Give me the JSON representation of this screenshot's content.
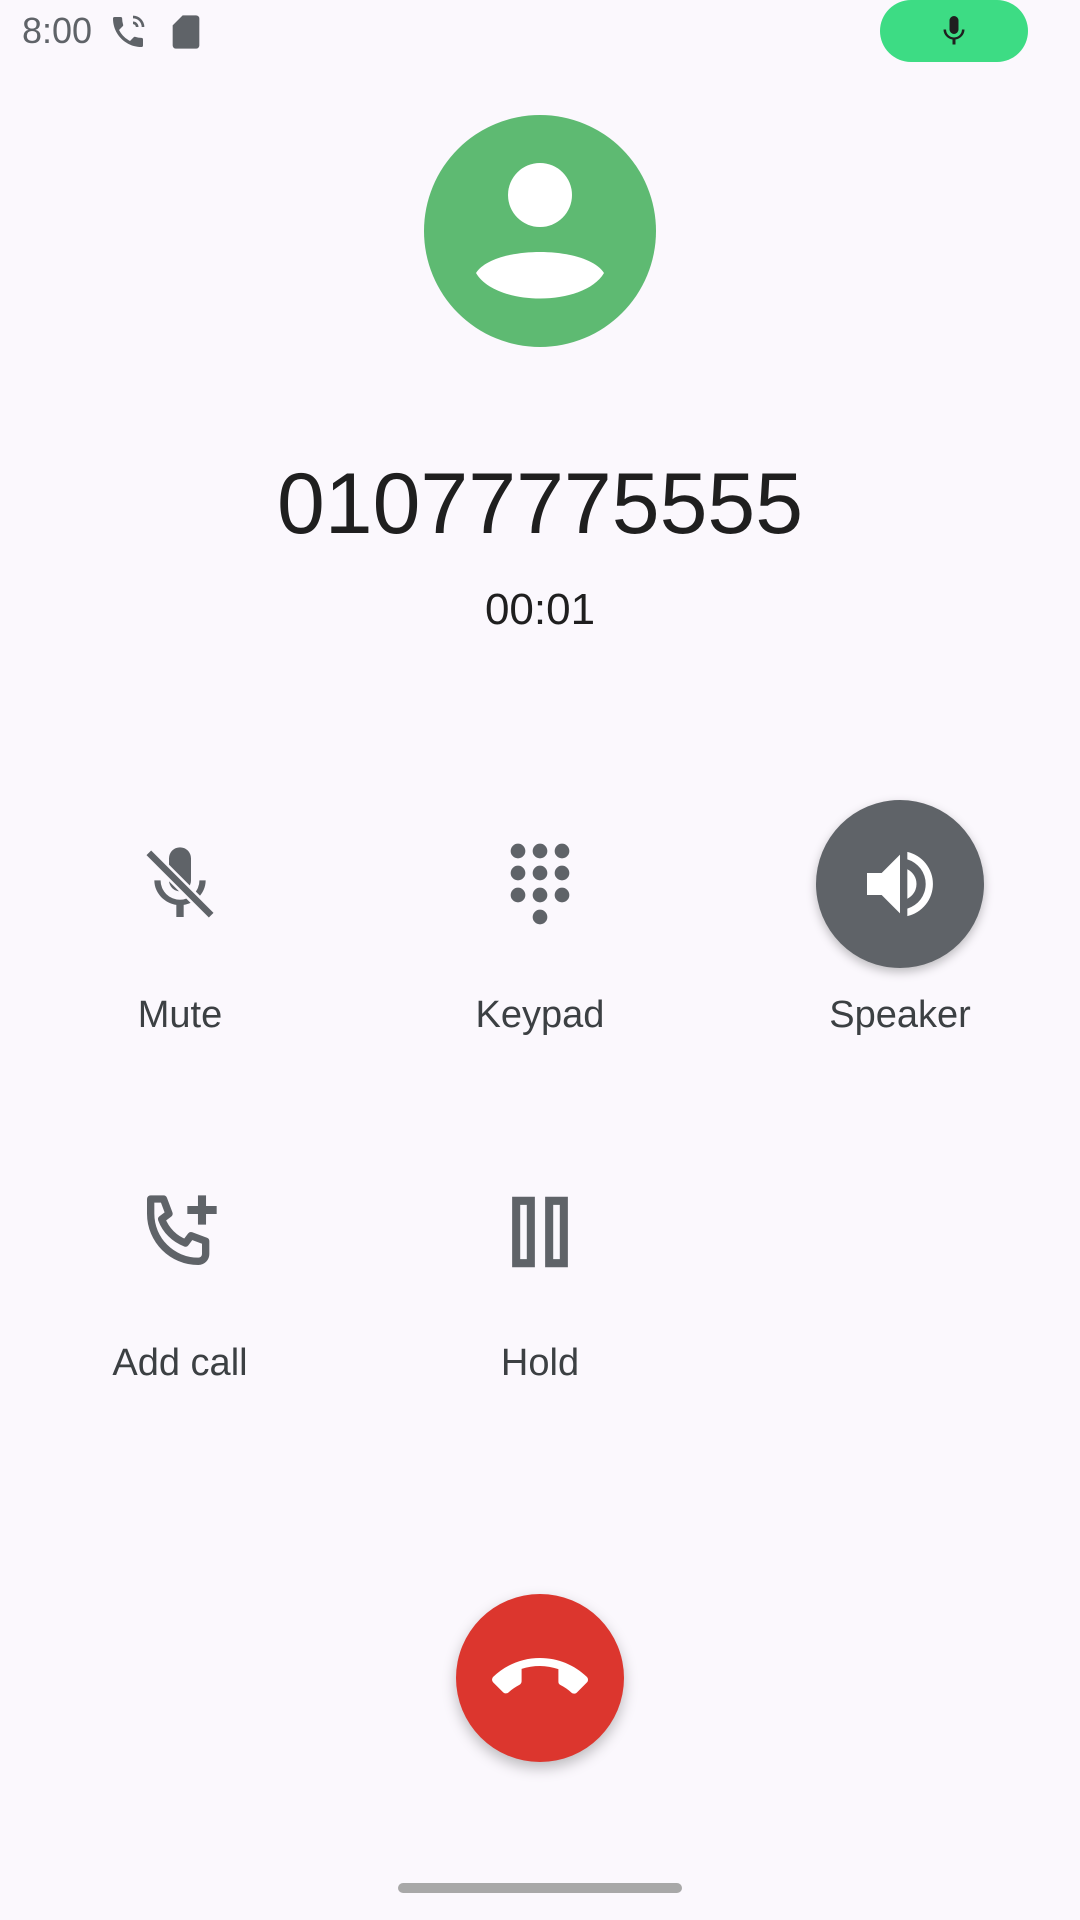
{
  "status_bar": {
    "time": "8:00",
    "icons": [
      "call-forwarding-icon",
      "sd-card-icon"
    ],
    "mic_indicator": "mic-icon",
    "mic_pill_color": "#3ddc84"
  },
  "call": {
    "avatar_icon": "person-icon",
    "avatar_color": "#5eba72",
    "number": "01077775555",
    "timer": "00:01"
  },
  "actions": [
    {
      "label": "Mute",
      "icon": "mic-off-icon",
      "active": false
    },
    {
      "label": "Keypad",
      "icon": "dialpad-icon",
      "active": false
    },
    {
      "label": "Speaker",
      "icon": "speaker-icon",
      "active": true
    },
    {
      "label": "Add call",
      "icon": "add-call-icon",
      "active": false
    },
    {
      "label": "Hold",
      "icon": "pause-icon",
      "active": false
    }
  ],
  "end_call": {
    "icon": "call-end-icon",
    "color": "#dc362e"
  }
}
